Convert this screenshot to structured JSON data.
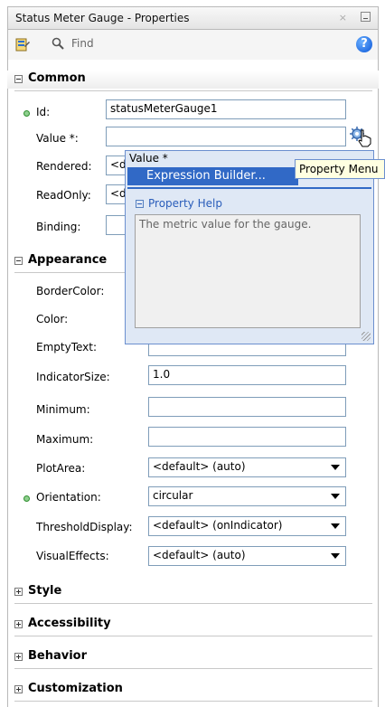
{
  "window": {
    "title": "Status Meter Gauge - Properties",
    "close_glyph": "×"
  },
  "toolbar": {
    "find_placeholder": "Find",
    "help_glyph": "?"
  },
  "sections": {
    "common": "Common",
    "appearance": "Appearance",
    "style": "Style",
    "accessibility": "Accessibility",
    "behavior": "Behavior",
    "customization": "Customization"
  },
  "common": {
    "id_label": "Id:",
    "id_value": "statusMeterGauge1",
    "value_label": "Value *:",
    "value_value": "",
    "rendered_label": "Rendered:",
    "rendered_value": "<d",
    "readonly_label": "ReadOnly:",
    "readonly_value": "<d",
    "binding_label": "Binding:",
    "binding_value": ""
  },
  "appearance": {
    "bordercolor_label": "BorderColor:",
    "color_label": "Color:",
    "emptytext_label": "EmptyText:",
    "emptytext_value": "",
    "indicatorsize_label": "IndicatorSize:",
    "indicatorsize_value": "1.0",
    "minimum_label": "Minimum:",
    "minimum_value": "",
    "maximum_label": "Maximum:",
    "maximum_value": "",
    "plotarea_label": "PlotArea:",
    "plotarea_value": "<default> (auto)",
    "orientation_label": "Orientation:",
    "orientation_value": "circular",
    "thresholddisplay_label": "ThresholdDisplay:",
    "thresholddisplay_value": "<default> (onIndicator)",
    "visualeffects_label": "VisualEffects:",
    "visualeffects_value": "<default> (auto)"
  },
  "popup": {
    "title": "Value *",
    "menu_item": "Expression Builder...",
    "property_help_title": "Property Help",
    "property_help_text": "The metric value for the gauge."
  },
  "tooltip": {
    "text": "Property Menu"
  },
  "colors": {
    "selection_blue": "#3169c6",
    "popup_bg": "#dfe8f5",
    "field_border": "#7f9db9",
    "required_dot": "#2f8f2f"
  }
}
